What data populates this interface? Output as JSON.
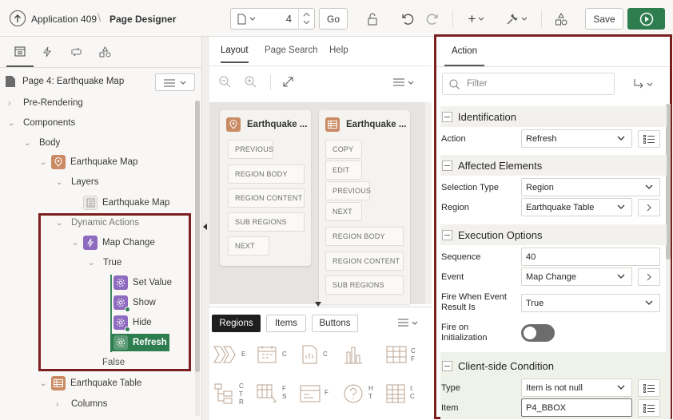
{
  "header": {
    "app_title": "Application 409",
    "page_designer": "Page Designer",
    "page_number": "4",
    "go_label": "Go",
    "add_label": "+",
    "save_label": "Save"
  },
  "left_panel": {
    "page_title": "Page 4: Earthquake Map",
    "tree": {
      "pre_rendering": "Pre-Rendering",
      "components": "Components",
      "body": "Body",
      "earthquake_map_region": "Earthquake Map",
      "layers": "Layers",
      "earthquake_map_layer": "Earthquake Map",
      "dynamic_actions": "Dynamic Actions",
      "map_change": "Map Change",
      "true": "True",
      "set_value": "Set Value",
      "show": "Show",
      "hide": "Hide",
      "refresh": "Refresh",
      "false": "False",
      "earthquake_table": "Earthquake Table",
      "columns": "Columns"
    }
  },
  "middle_panel": {
    "tabs": [
      "Layout",
      "Page Search",
      "Help"
    ],
    "cards": [
      {
        "title": "Earthquake ...",
        "buttons": [
          "PREVIOUS",
          "REGION BODY",
          "REGION CONTENT",
          "SUB REGIONS",
          "NEXT"
        ]
      },
      {
        "title": "Earthquake ...",
        "buttons": [
          "COPY",
          "EDIT",
          "PREVIOUS",
          "NEXT",
          "REGION BODY",
          "REGION CONTENT",
          "SUB REGIONS"
        ]
      }
    ],
    "gallery_tabs": [
      "Regions",
      "Items",
      "Buttons"
    ],
    "gallery_letters_row1": [
      "E",
      "C",
      "C",
      "",
      "C F"
    ],
    "gallery_letters_row2": [
      "C T R",
      "F S",
      "F",
      "H T",
      "I: C"
    ]
  },
  "right_panel": {
    "tab": "Action",
    "filter_placeholder": "Filter",
    "sections": {
      "identification": "Identification",
      "affected": "Affected Elements",
      "execution": "Execution Options",
      "condition": "Client-side Condition"
    },
    "props": {
      "action_label": "Action",
      "action_value": "Refresh",
      "sel_type_label": "Selection Type",
      "sel_type_value": "Region",
      "region_label": "Region",
      "region_value": "Earthquake Table",
      "sequence_label": "Sequence",
      "sequence_value": "40",
      "event_label": "Event",
      "event_value": "Map Change",
      "fire_result_label_1": "Fire When Event",
      "fire_result_label_2": "Result Is",
      "fire_result_value": "True",
      "fire_init_label_1": "Fire on",
      "fire_init_label_2": "Initialization",
      "type_label": "Type",
      "type_value": "Item is not null",
      "item_label": "Item",
      "item_value": "P4_BBOX"
    }
  },
  "colors": {
    "accent_green": "#2e7d4f",
    "highlight_border": "#7c1f1f",
    "da_purple": "#8e6bbf",
    "region_orange": "#c98a64"
  }
}
